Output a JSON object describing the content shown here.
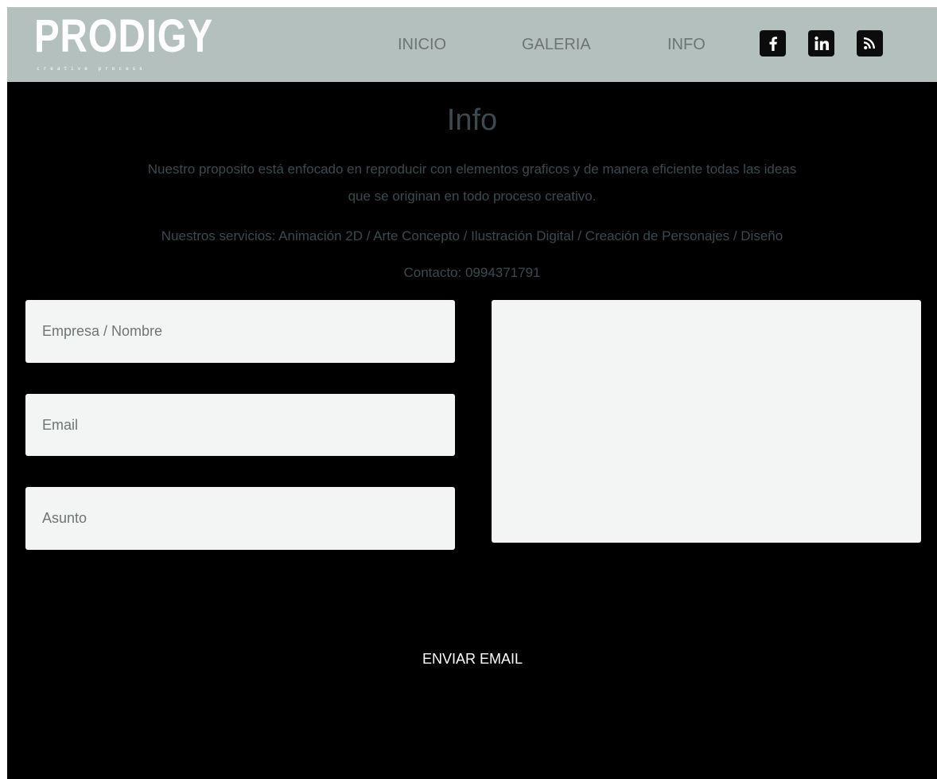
{
  "header": {
    "logo_text": "PRODIGY",
    "logo_tagline": "creative process",
    "nav": {
      "inicio": "INICIO",
      "galeria": "GALERIA",
      "info": "INFO"
    },
    "social_icons": [
      "facebook-icon",
      "linkedin-icon",
      "rss-icon"
    ]
  },
  "content": {
    "title": "Info",
    "description_line1": "Nuestro proposito está enfocado en reproducir con elementos graficos y de manera eficiente todas las ideas",
    "description_line2": "que se originan en todo proceso creativo.",
    "services": "Nuestros servicios: Animación 2D / Arte Concepto / Ilustración Digital / Creación de Personajes / Diseño",
    "contact": "Contacto: 0994371791"
  },
  "form": {
    "name_placeholder": "Empresa / Nombre",
    "email_placeholder": "Email",
    "subject_placeholder": "Asunto",
    "message_value": "",
    "send_label": "ENVIAR EMAIL"
  },
  "colors": {
    "header_bg": "#b4c0be",
    "page_bg": "#000000",
    "nav_text": "#6b7571",
    "body_text": "#3a4a50",
    "field_bg": "#f3f4f4"
  }
}
